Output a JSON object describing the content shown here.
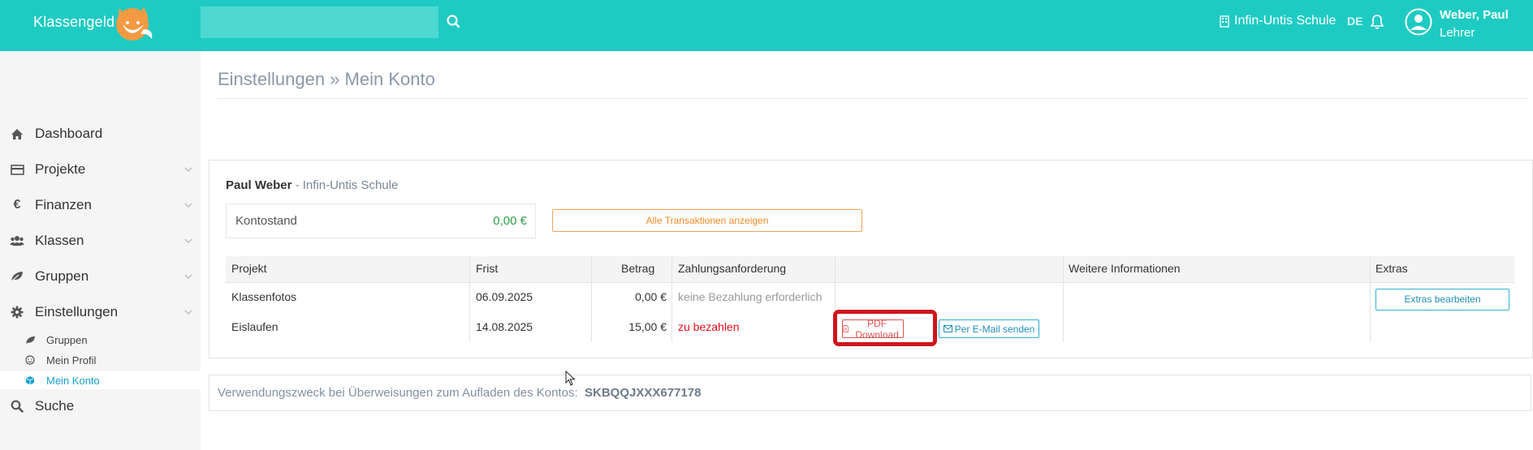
{
  "app": {
    "brand": "Klassengeld"
  },
  "header": {
    "search": {
      "value": "",
      "placeholder": ""
    },
    "school": "Infin-Untis Schule",
    "language": "DE",
    "user_name": "Weber, Paul",
    "user_role": "Lehrer"
  },
  "sidebar": {
    "items": [
      {
        "label": "Dashboard",
        "icon": "home-icon"
      },
      {
        "label": "Projekte",
        "icon": "credit-card-icon"
      },
      {
        "label": "Finanzen",
        "icon": "euro-icon"
      },
      {
        "label": "Klassen",
        "icon": "users-icon"
      },
      {
        "label": "Gruppen",
        "icon": "leaf-icon"
      },
      {
        "label": "Einstellungen",
        "icon": "gear-icon"
      },
      {
        "label": "Suche",
        "icon": "search-icon"
      }
    ],
    "settings_sub": [
      {
        "label": "Gruppen",
        "icon": "leaf-icon"
      },
      {
        "label": "Mein Profil",
        "icon": "smile-icon"
      },
      {
        "label": "Mein Konto",
        "icon": "cube-icon",
        "active": true
      }
    ],
    "active_color": "#1a9fd0"
  },
  "main": {
    "title": "Einstellungen » Mein Konto",
    "owner_name": "Paul Weber",
    "owner_school": "- Infin-Untis Schule",
    "balance_label": "Kontostand",
    "balance_value": "0,00 €",
    "transactions_button": "Alle Transaktionen anzeigen",
    "table": {
      "headers": [
        "Projekt",
        "Frist",
        "Betrag",
        "Zahlungsanforderung",
        "",
        "Weitere Informationen",
        "Extras"
      ],
      "rows": [
        {
          "projekt": "Klassenfotos",
          "frist": "06.09.2025",
          "betrag": "0,00 €",
          "anforderung": "keine Bezahlung erforderlich"
        },
        {
          "projekt": "Eislaufen",
          "frist": "14.08.2025",
          "betrag": "15,00 €",
          "anforderung": "zu bezahlen"
        }
      ],
      "pdf_button": "PDF Download",
      "mail_button": "Per E-Mail senden",
      "extras_button": "Extras bearbeiten"
    },
    "purpose_label": "Verwendungszweck bei Überweisungen zum Aufladen des Kontos:",
    "purpose_code": "SKBQQJXXX677178"
  },
  "colors": {
    "topbar": "#1ecbc3",
    "balance_positive": "#2e9e44",
    "due": "#e3101d",
    "highlight": "#d0151c",
    "transactions_button": "#f08a24"
  }
}
